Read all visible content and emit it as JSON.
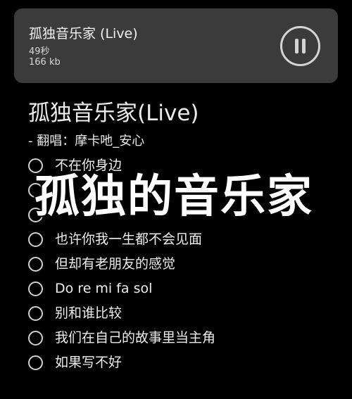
{
  "player": {
    "title": "孤独音乐家 (Live)",
    "duration": "49秒",
    "size": "166 kb",
    "pause_icon": "pause-icon"
  },
  "song": {
    "title": "孤独音乐家(Live)",
    "singer_line": "-  翻唱：摩卡吔_安心"
  },
  "overlay_caption": "孤独的音乐家",
  "lyrics": [
    {
      "text": "不在你身边",
      "selected": false
    },
    {
      "text": "",
      "selected": false
    },
    {
      "text": "",
      "selected": false
    },
    {
      "text": "也许你我一生都不会见面",
      "selected": false
    },
    {
      "text": "但却有老朋友的感觉",
      "selected": false
    },
    {
      "text": "Do re mi fa sol",
      "selected": false
    },
    {
      "text": "别和谁比较",
      "selected": false
    },
    {
      "text": "我们在自己的故事里当主角",
      "selected": false
    },
    {
      "text": "如果写不好",
      "selected": false
    }
  ]
}
